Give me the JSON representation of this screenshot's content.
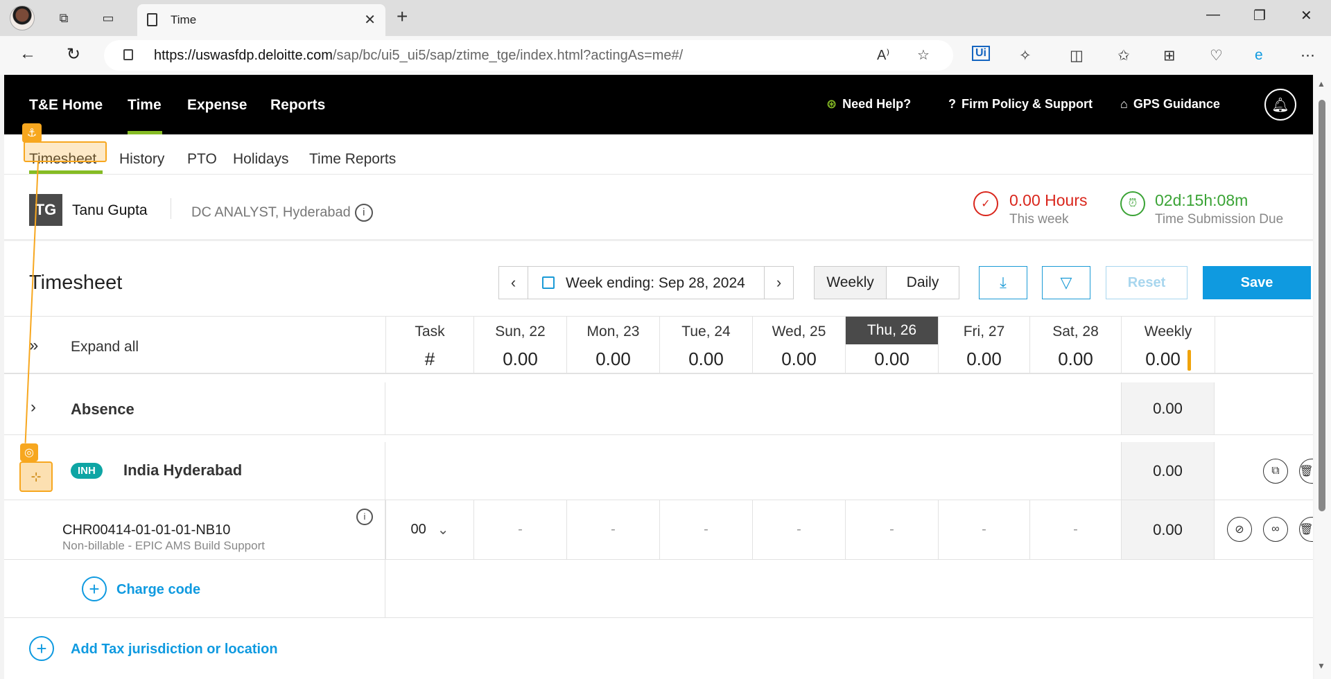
{
  "browser": {
    "tab_title": "Time",
    "url_host": "https://uswasfdp.deloitte.com",
    "url_path": "/sap/bc/ui5_ui5/sap/ztime_tge/index.html?actingAs=me#/",
    "window_controls": [
      "minimize-icon",
      "restore-icon",
      "close-icon"
    ]
  },
  "topnav": {
    "items": [
      "T&E Home",
      "Time",
      "Expense",
      "Reports"
    ],
    "active": "Time",
    "need_help": "Need Help?",
    "firm_policy": "Firm Policy & Support",
    "gps": "GPS Guidance"
  },
  "subnav": {
    "items": [
      "Timesheet",
      "History",
      "PTO",
      "Holidays",
      "Time Reports"
    ],
    "active": "Timesheet"
  },
  "user": {
    "initials": "TG",
    "name": "Tanu Gupta",
    "role": "DC ANALYST, Hyderabad",
    "hours_value": "0.00 Hours",
    "hours_label": "This week",
    "due_value": "02d:15h:08m",
    "due_label": "Time Submission Due"
  },
  "timesheet": {
    "title": "Timesheet",
    "week_label": "Week ending: Sep 28, 2024",
    "view_weekly": "Weekly",
    "view_daily": "Daily",
    "reset": "Reset",
    "save": "Save"
  },
  "grid": {
    "expand_all": "Expand all",
    "task_header": "Task",
    "task_sub": "#",
    "days": [
      {
        "label": "Sun, 22",
        "total": "0.00"
      },
      {
        "label": "Mon, 23",
        "total": "0.00"
      },
      {
        "label": "Tue, 24",
        "total": "0.00"
      },
      {
        "label": "Wed, 25",
        "total": "0.00"
      },
      {
        "label": "Thu, 26",
        "total": "0.00"
      },
      {
        "label": "Fri, 27",
        "total": "0.00"
      },
      {
        "label": "Sat, 28",
        "total": "0.00"
      }
    ],
    "today_index": 4,
    "weekly_header": "Weekly",
    "weekly_total": "0.00"
  },
  "rows": {
    "absence": {
      "label": "Absence",
      "weekly": "0.00"
    },
    "location": {
      "badge": "INH",
      "label": "India Hyderabad",
      "weekly": "0.00"
    },
    "charge": {
      "code": "CHR00414-01-01-01-NB10",
      "desc": "Non-billable - EPIC AMS Build Support",
      "task": "00",
      "day_values": [
        "-",
        "-",
        "-",
        "-",
        "-",
        "-",
        "-"
      ],
      "weekly": "0.00"
    },
    "add_charge_code": "Charge code",
    "add_tax": "Add Tax jurisdiction or location"
  },
  "colors": {
    "accent": "#0f9ae0",
    "brand_green": "#86bc25",
    "hours_red": "#d9261c",
    "due_green": "#3aa335",
    "highlight": "#f7a71f"
  }
}
